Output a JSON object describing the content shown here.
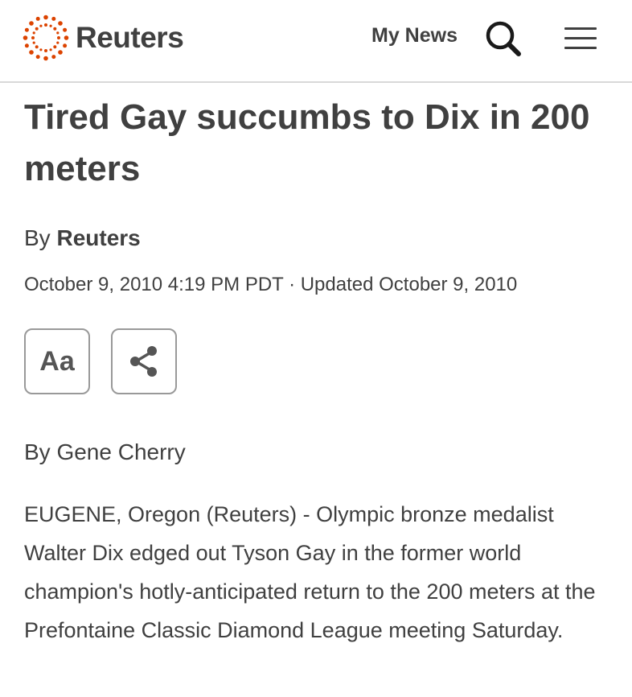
{
  "header": {
    "logo_text": "Reuters",
    "my_news_label": "My News",
    "search_icon": "search-icon",
    "menu_icon": "hamburger-menu-icon",
    "brand_color": "#dc4300"
  },
  "article": {
    "headline": "Tired Gay succumbs to Dix in 200 meters",
    "byline_prefix": "By",
    "byline_source": "Reuters",
    "dateline": "October 9, 2010 4:19 PM PDT · Updated October 9, 2010",
    "font_button_label": "Aa",
    "share_icon": "share-icon",
    "author_line": "By Gene Cherry",
    "body": "EUGENE, Oregon (Reuters) - Olympic bronze medalist Walter Dix edged out Tyson Gay in the former world champion's hotly-anticipated return to the 200 meters at the Prefontaine Classic Diamond League meeting Saturday."
  }
}
